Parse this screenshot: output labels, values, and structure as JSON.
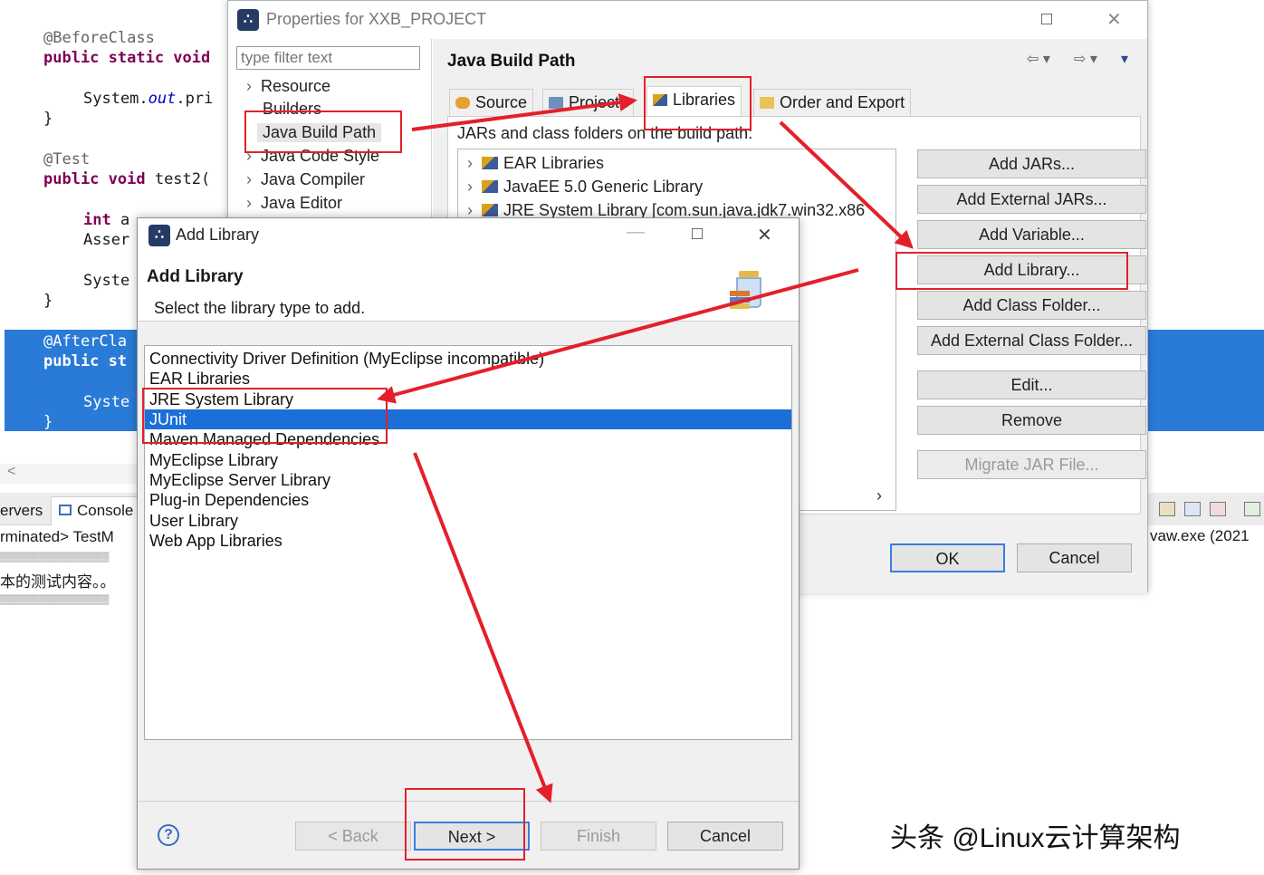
{
  "editor": {
    "lines": {
      "l1": "@BeforeClass",
      "l2_kw": "public static void",
      "l3_a": "System.",
      "l3_b": "out",
      "l3_c": ".pri",
      "l4": "}",
      "l5": "@Test",
      "l6_kw": "public void",
      "l6_rest": " test2(",
      "l7_kw": "int",
      "l7_rest": " a",
      "l8": "Asser",
      "l9": "Syste",
      "l10": "}",
      "l11": "@AfterCla",
      "l12": "public st",
      "l13": "Syste",
      "l14": "}"
    },
    "scroll_left": "<"
  },
  "console": {
    "tab_servers": "ervers",
    "tab_console": "Console",
    "terminated": "rminated> TestM",
    "garbled1": "▒▒▒▒▒▒▒▒▒▒▒▒▒▒▒▒▒",
    "chinese_line": "本的测试内容。。",
    "garbled2": "▒▒▒▒▒▒▒▒▒▒▒▒▒▒▒▒▒",
    "right_status": "vaw.exe (2021"
  },
  "properties": {
    "title": "Properties for XXB_PROJECT",
    "filter_placeholder": "type filter text",
    "tree": [
      "Resource",
      "Builders",
      "Java Build Path",
      "Java Code Style",
      "Java Compiler",
      "Java Editor"
    ],
    "heading": "Java Build Path",
    "tabs": [
      "Source",
      "Projects",
      "Libraries",
      "Order and Export"
    ],
    "jars_label": "JARs and class folders on the build path:",
    "libraries": [
      "EAR Libraries",
      "JavaEE 5.0 Generic Library",
      "JRE System Library [com.sun.java.jdk7.win32.x86"
    ],
    "buttons": {
      "add_jars": "Add JARs...",
      "add_external_jars": "Add External JARs...",
      "add_variable": "Add Variable...",
      "add_library": "Add Library...",
      "add_class_folder": "Add Class Folder...",
      "add_external_class_folder": "Add External Class Folder...",
      "edit": "Edit...",
      "remove": "Remove",
      "migrate": "Migrate JAR File..."
    },
    "ok": "OK",
    "cancel": "Cancel"
  },
  "add_library": {
    "title": "Add Library",
    "heading": "Add Library",
    "description": "Select the library type to add.",
    "types": [
      "Connectivity Driver Definition (MyEclipse incompatible)",
      "EAR Libraries",
      "JRE System Library",
      "JUnit",
      "Maven Managed Dependencies",
      "MyEclipse Library",
      "MyEclipse Server Library",
      "Plug-in Dependencies",
      "User Library",
      "Web App Libraries"
    ],
    "selected": "JUnit",
    "buttons": {
      "back": "< Back",
      "next": "Next >",
      "finish": "Finish",
      "cancel": "Cancel"
    }
  },
  "watermark": "头条 @Linux云计算架构",
  "colors": {
    "annotation_red": "#e3202a",
    "selection_blue": "#1b6fd6",
    "keyword": "#7f0055",
    "default_button_border": "#3b7ddd"
  }
}
